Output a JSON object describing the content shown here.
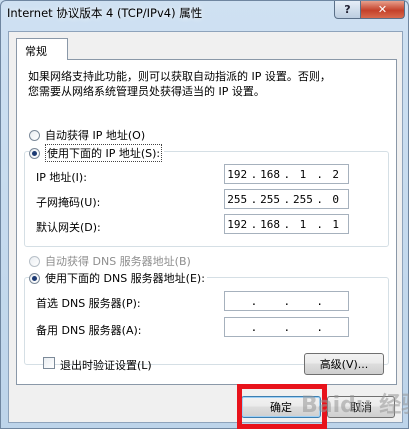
{
  "window": {
    "title": "Internet 协议版本 4 (TCP/IPv4) 属性",
    "help_label": "?",
    "close_label": "✕"
  },
  "tabs": [
    {
      "label": "常规"
    }
  ],
  "description": {
    "line1": "如果网络支持此功能，则可以获取自动指派的 IP 设置。否则，",
    "line2": "您需要从网络系统管理员处获得适当的 IP 设置。"
  },
  "ip_section": {
    "auto_label": "自动获得 IP 地址(O)",
    "manual_label": "使用下面的 IP 地址(S):",
    "selected": "manual",
    "fields": [
      {
        "label": "IP 地址(I):",
        "octets": [
          "192",
          "168",
          "1",
          "2"
        ]
      },
      {
        "label": "子网掩码(U):",
        "octets": [
          "255",
          "255",
          "255",
          "0"
        ]
      },
      {
        "label": "默认网关(D):",
        "octets": [
          "192",
          "168",
          "1",
          "1"
        ]
      }
    ]
  },
  "dns_section": {
    "auto_label": "自动获得 DNS 服务器地址(B)",
    "manual_label": "使用下面的 DNS 服务器地址(E):",
    "selected": "manual",
    "fields": [
      {
        "label": "首选 DNS 服务器(P):",
        "octets": [
          "",
          "",
          "",
          ""
        ]
      },
      {
        "label": "备用 DNS 服务器(A):",
        "octets": [
          "",
          "",
          "",
          ""
        ]
      }
    ]
  },
  "validate_on_exit": {
    "label": "退出时验证设置(L)",
    "checked": false
  },
  "advanced_button": "高级(V)...",
  "ok_button": "确定",
  "cancel_button": "取消",
  "watermark": "Baidu 经验",
  "colors": {
    "highlight": "#e8131b",
    "close": "#c4412a"
  }
}
